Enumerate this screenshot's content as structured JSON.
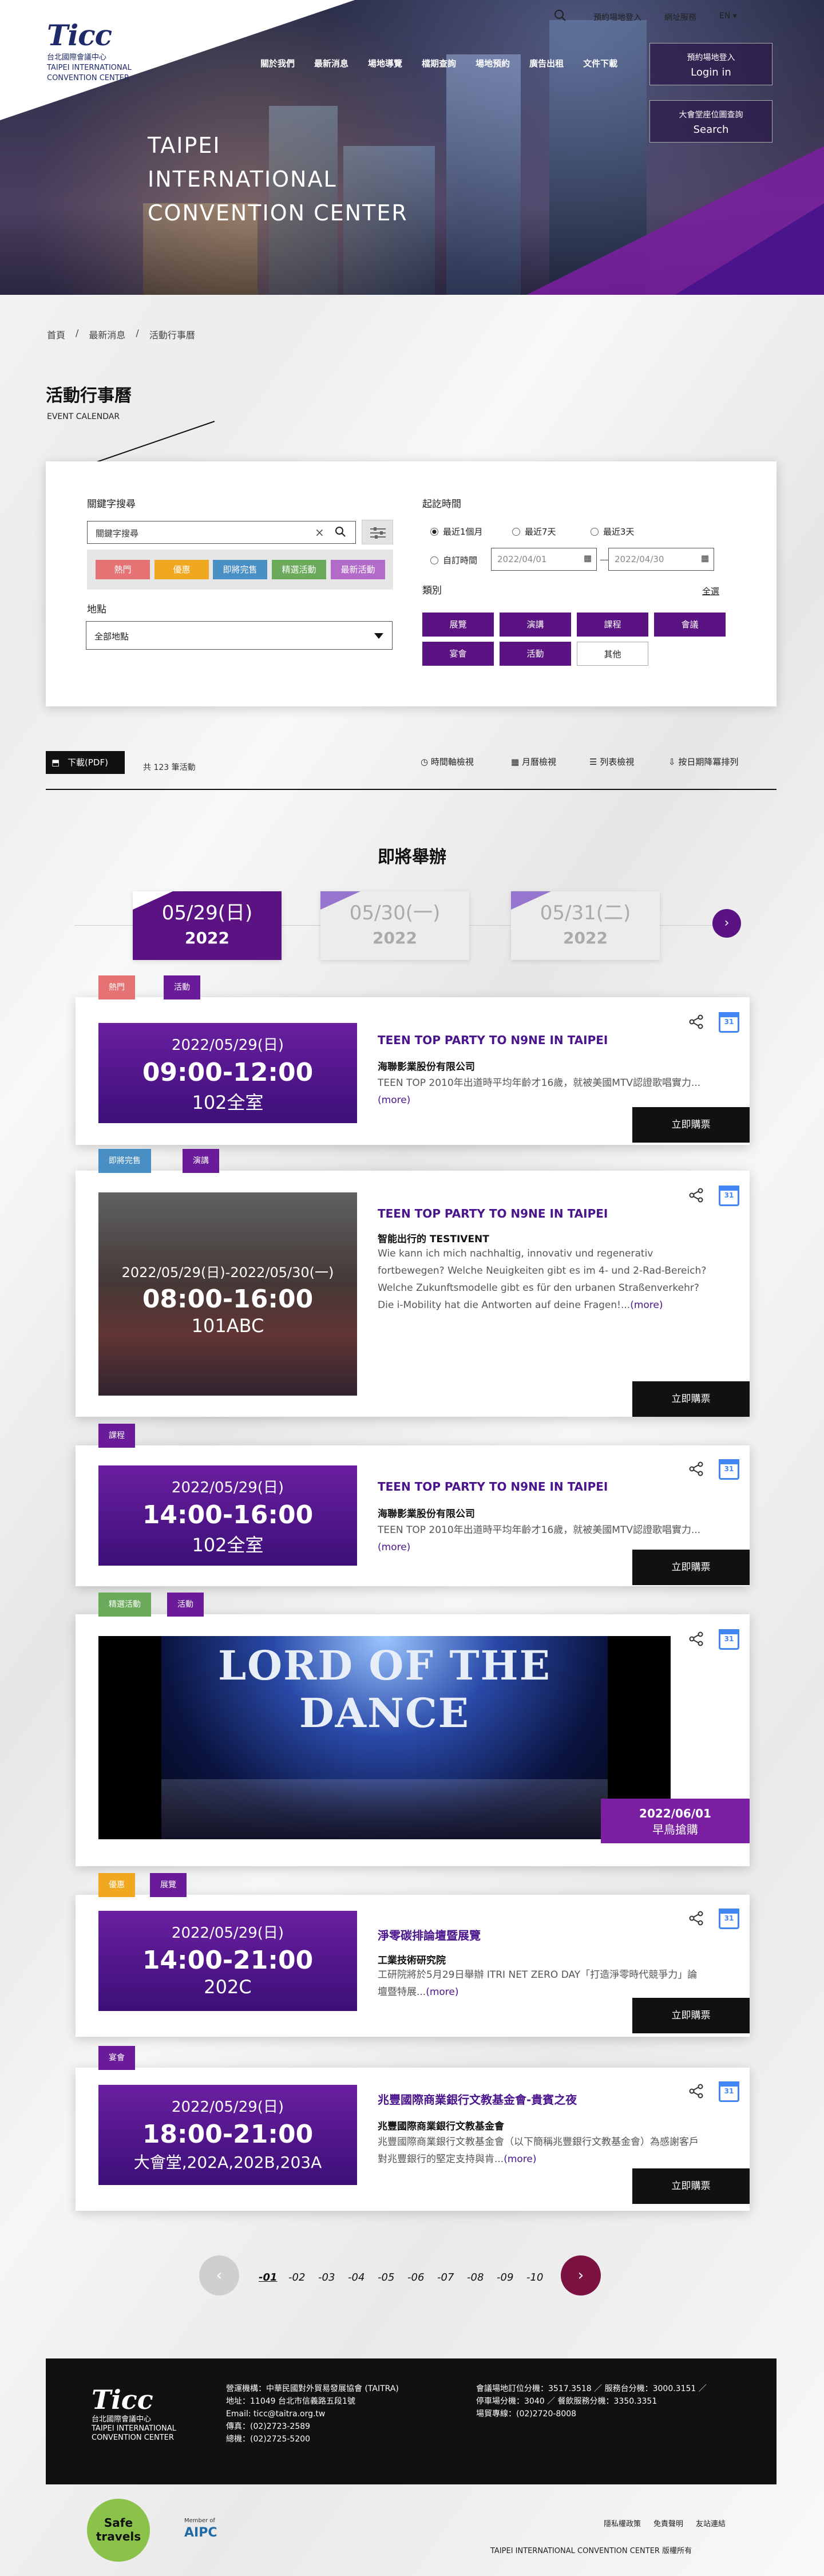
{
  "header": {
    "logo_big": "Ticc",
    "logo_lines": [
      "台北國際會議中心",
      "TAIPEI INTERNATIONAL",
      "CONVENTION CENTER"
    ],
    "top_links": [
      "預約場地登入",
      "網址服務",
      "EN"
    ],
    "nav": [
      "關於我們",
      "最新消息",
      "場地導覽",
      "檔期查詢",
      "場地預約",
      "廣告出租",
      "文件下載"
    ],
    "btn_login_1": "預約場地登入",
    "btn_login_2": "Login in",
    "btn_search_1": "大會堂座位圖查詢",
    "btn_search_2": "Search",
    "hero_title": [
      "TAIPEI",
      "INTERNATIONAL",
      "CONVENTION CENTER"
    ]
  },
  "breadcrumb": [
    "首頁",
    "最新消息",
    "活動行事曆"
  ],
  "page_title": "活動行事曆",
  "page_subtitle": "EVENT CALENDAR",
  "filter": {
    "keyword_label": "關鍵字搜尋",
    "keyword_placeholder": "關鍵字搜尋",
    "tags": [
      {
        "label": "熱門",
        "color": "#e57373"
      },
      {
        "label": "優惠",
        "color": "#f0a820"
      },
      {
        "label": "即將完售",
        "color": "#4a8fc4"
      },
      {
        "label": "精選活動",
        "color": "#6aaa5a"
      },
      {
        "label": "最新活動",
        "color": "#b36bc9"
      }
    ],
    "location_label": "地點",
    "location_value": "全部地點",
    "period_label": "起訖時間",
    "periods": [
      "最近1個月",
      "最近7天",
      "最近3天"
    ],
    "custom_label": "自訂時間",
    "date_from": "2022/04/01",
    "date_to": "2022/04/30",
    "category_label": "類別",
    "select_all": "全選",
    "categories": [
      "展覽",
      "演講",
      "課程",
      "會議",
      "宴會",
      "活動",
      "其他"
    ]
  },
  "toolbar": {
    "download": "下載(PDF)",
    "count": "共 123 筆活動",
    "views": [
      "時間軸檢視",
      "月曆檢視",
      "列表檢視",
      "按日期降冪排列"
    ]
  },
  "upcoming": {
    "title": "即將舉辦",
    "dates": [
      {
        "d": "05/29(日)",
        "y": "2022"
      },
      {
        "d": "05/30(一)",
        "y": "2022"
      },
      {
        "d": "05/31(二)",
        "y": "2022"
      }
    ]
  },
  "events": [
    {
      "tags": [
        "熱門",
        "活動"
      ],
      "date": "2022/05/29(日)",
      "time": "09:00-12:00",
      "venue": "102全室",
      "title": "TEEN TOP PARTY TO N9NE IN TAIPEI",
      "org": "海聯影業股份有限公司",
      "desc": "TEEN TOP 2010年出道時平均年齡才16歲，就被美國MTV認證歌唱實力...",
      "more": "(more)",
      "buy": "立即購票"
    },
    {
      "tags": [
        "即將完售",
        "演講"
      ],
      "date": "2022/05/29(日)-2022/05/30(一)",
      "time": "08:00-16:00",
      "venue": "101ABC",
      "title": "TEEN TOP PARTY TO N9NE IN TAIPEI",
      "org": "智能出行的 TESTIVENT",
      "desc": "Wie kann ich mich nachhaltig, innovativ und regenerativ fortbewegen? Welche Neuigkeiten gibt es im 4- und 2-Rad-Bereich? Welche Zukunftsmodelle gibt es für den urbanen Straßenverkehr? Die i-Mobility hat die Antworten auf deine Fragen!...",
      "more": "(more)",
      "buy": "立即購票"
    },
    {
      "tags": [
        "課程"
      ],
      "date": "2022/05/29(日)",
      "time": "14:00-16:00",
      "venue": "102全室",
      "title": "TEEN TOP PARTY TO N9NE IN TAIPEI",
      "org": "海聯影業股份有限公司",
      "desc": "TEEN TOP 2010年出道時平均年齡才16歲，就被美國MTV認證歌唱實力...",
      "more": "(more)",
      "buy": "立即購票"
    },
    {
      "tags": [
        "精選活動",
        "活動"
      ],
      "image_text": "LORD OF THE DANCE",
      "date_badge": "2022/06/01",
      "badge_sub": "早鳥搶購"
    },
    {
      "tags": [
        "優惠",
        "展覽"
      ],
      "date": "2022/05/29(日)",
      "time": "14:00-21:00",
      "venue": "202C",
      "title": "淨零碳排論壇暨展覽",
      "org": "工業技術研究院",
      "desc": "工研院將於5月29日舉辦 ITRI NET ZERO DAY「打造淨零時代競爭力」論壇暨特展...",
      "more": "(more)",
      "buy": "立即購票"
    },
    {
      "tags": [
        "宴會"
      ],
      "date": "2022/05/29(日)",
      "time": "18:00-21:00",
      "venue": "大會堂,202A,202B,203A",
      "title": "兆豐國際商業銀行文教基金會-貴賓之夜",
      "org": "兆豐國際商業銀行文教基金會",
      "desc": "兆豐國際商業銀行文教基金會（以下簡稱兆豐銀行文教基金會）為感謝客戶對兆豐銀行的堅定支持與肯...",
      "more": "(more)",
      "buy": "立即購票"
    }
  ],
  "pagination": [
    "01",
    "02",
    "03",
    "04",
    "05",
    "06",
    "07",
    "08",
    "09",
    "10"
  ],
  "footer": {
    "logo_big": "Ticc",
    "logo_lines": [
      "台北國際會議中心",
      "TAIPEI INTERNATIONAL",
      "CONVENTION CENTER"
    ],
    "col1": [
      "營運機構：中華民國對外貿易發展協會 (TAITRA)",
      "地址：11049 台北市信義路五段1號",
      "Email: ticc@taitra.org.tw",
      "傳真：(02)2723-2589",
      "總機：(02)2725-5200"
    ],
    "col2": [
      "會議場地訂位分機：3517.3518 ／ 服務台分機：3000.3151 ／",
      "停車場分機：3040 ／ 餐飲服務分機：3350.3351",
      "場貿專線：(02)2720-8008"
    ],
    "links": [
      "隱私權政策",
      "免責聲明",
      "友站連結"
    ],
    "badge": "Safe travels",
    "member": "Member of",
    "copyright": "TAIPEI INTERNATIONAL CONVENTION CENTER 版權所有"
  },
  "colors": {
    "brand": "#5b1282",
    "accent": "#8e24aa",
    "dark": "#111111"
  }
}
